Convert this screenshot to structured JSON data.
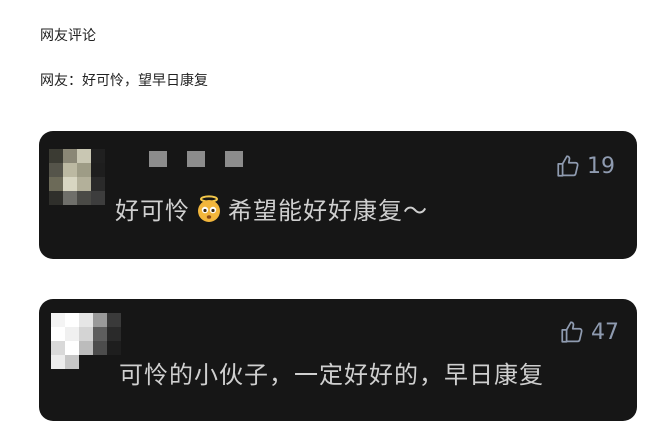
{
  "article": {
    "heading": "网友评论",
    "line": "网友：好可怜，望早日康复"
  },
  "comments": [
    {
      "likes": "19",
      "text_before": "好可怜",
      "emoji": "innocent-halo-face-emoji",
      "text_after": "希望能好好康复～"
    },
    {
      "likes": "47",
      "text": "可怜的小伙子，一定好好的，早日康复"
    }
  ],
  "icons": {
    "like": "thumbs-up-outline-icon"
  },
  "colors": {
    "card_background": "#161616",
    "comment_text": "#cfcfcf",
    "like_color": "#8f9bb0",
    "page_background": "#ffffff"
  }
}
